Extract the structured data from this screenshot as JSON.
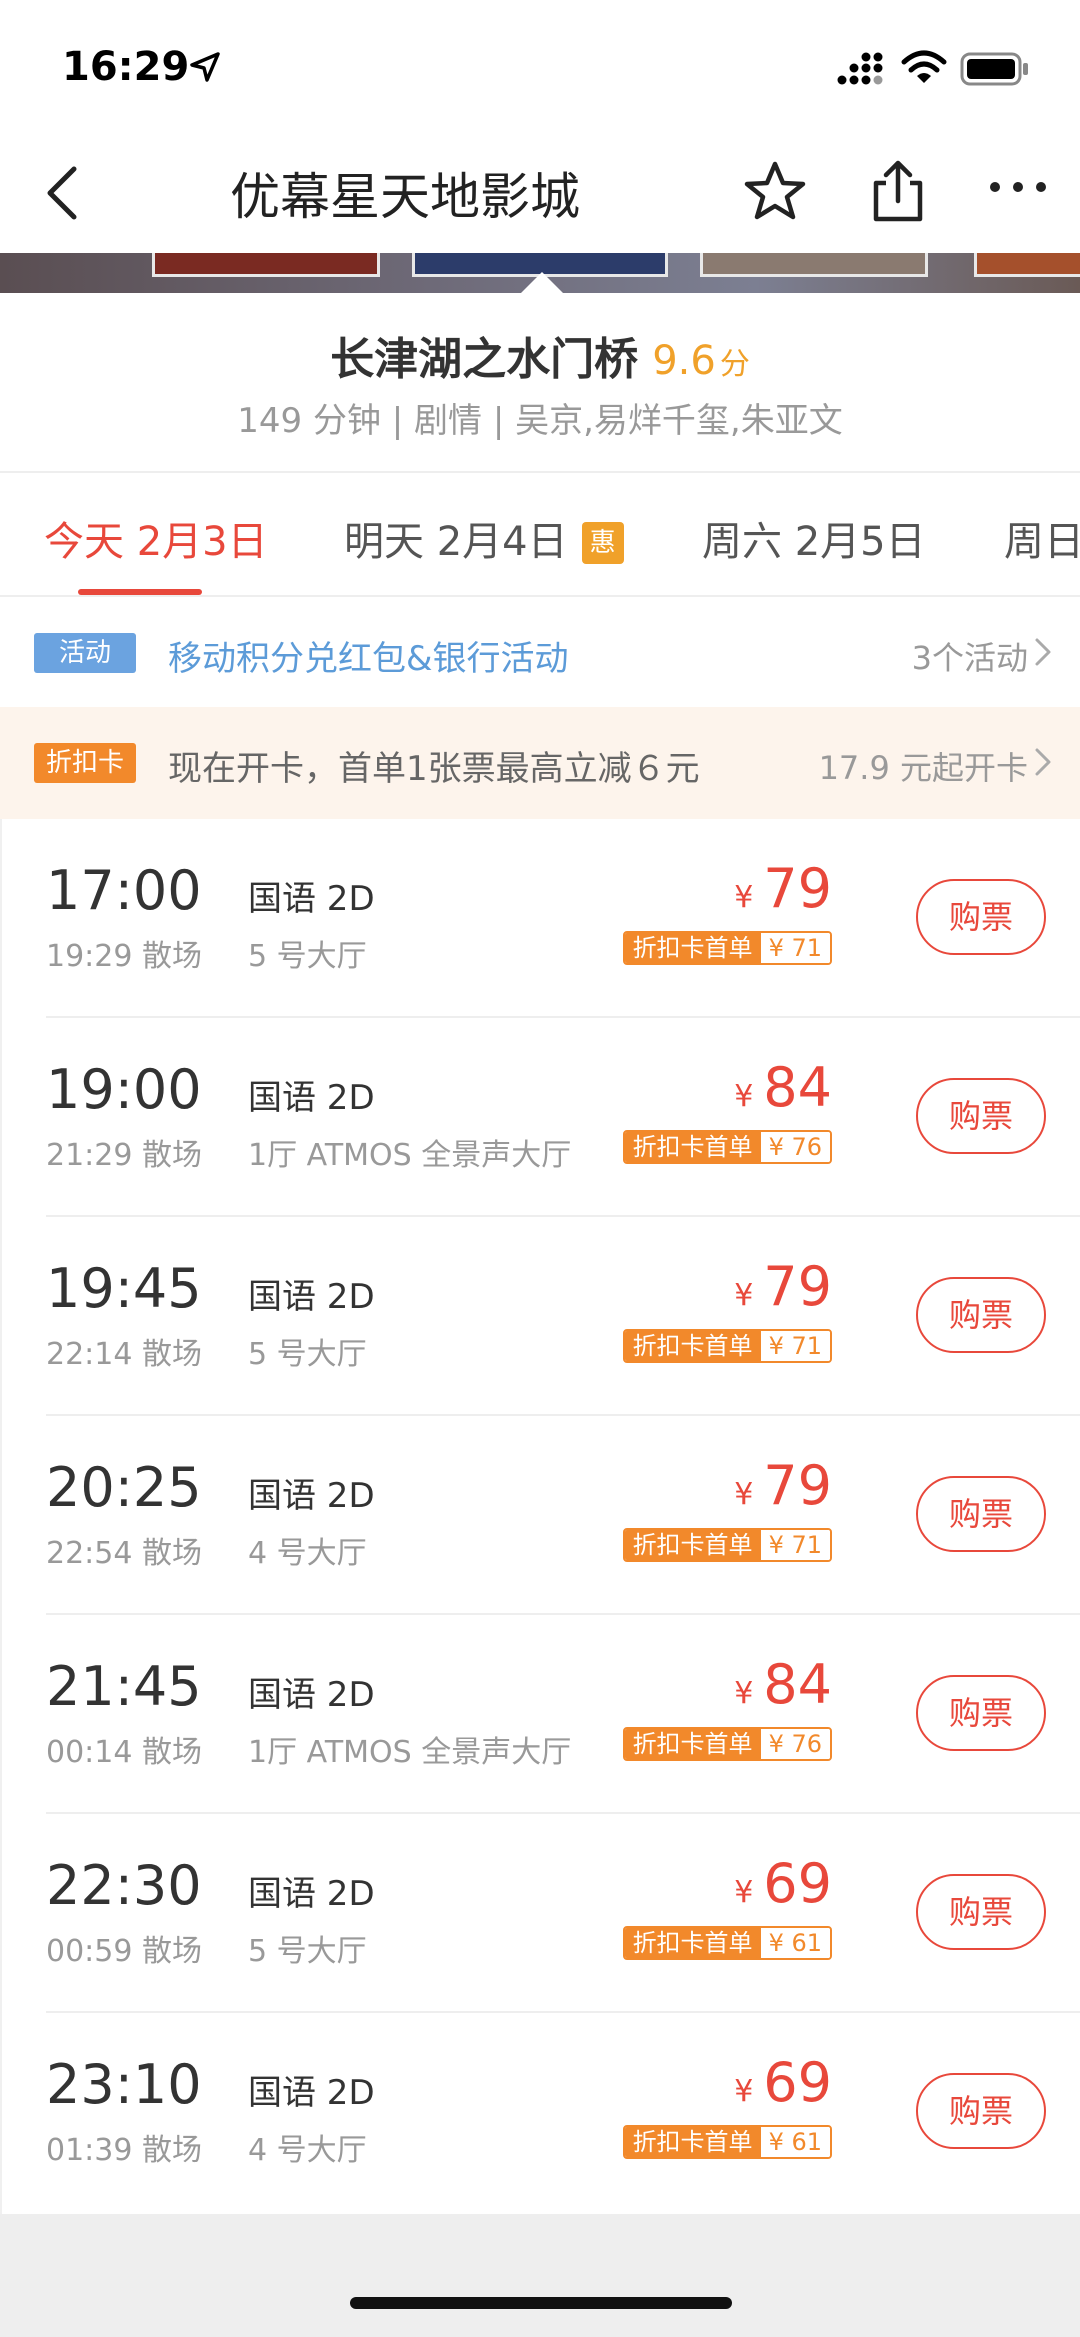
{
  "status_bar": {
    "time": "16:29",
    "icons": [
      "location-arrow-icon",
      "signal-icon",
      "wifi-icon",
      "battery-icon"
    ]
  },
  "nav": {
    "title": "优幕星天地影城",
    "icons": [
      "back-icon",
      "star-icon",
      "share-icon",
      "more-icon"
    ]
  },
  "movie": {
    "title": "长津湖之水门桥",
    "score": "9.6",
    "score_unit": "分",
    "meta": "149 分钟 | 剧情 | 吴京,易烊千玺,朱亚文"
  },
  "date_tabs": [
    {
      "label": "今天 2月3日",
      "active": true
    },
    {
      "label": "明天 2月4日",
      "badge": "惠"
    },
    {
      "label": "周六 2月5日"
    },
    {
      "label": "周日"
    }
  ],
  "activity": {
    "tag": "活动",
    "text": "移动积分兑红包&银行活动",
    "count": "3个活动"
  },
  "card_promo": {
    "tag": "折扣卡",
    "text": "现在开卡，首单1张票最高立减６元",
    "price": "17.9 元起开卡"
  },
  "showtimes": [
    {
      "start": "17:00",
      "end": "19:29 散场",
      "lang": "国语 2D",
      "hall": "5 号大厅",
      "currency": "¥",
      "price": "79",
      "discount_label": "折扣卡首单",
      "discount_price": "¥ 71",
      "buy": "购票"
    },
    {
      "start": "19:00",
      "end": "21:29 散场",
      "lang": "国语 2D",
      "hall": "1厅 ATMOS 全景声大厅",
      "currency": "¥",
      "price": "84",
      "discount_label": "折扣卡首单",
      "discount_price": "¥ 76",
      "buy": "购票"
    },
    {
      "start": "19:45",
      "end": "22:14 散场",
      "lang": "国语 2D",
      "hall": "5 号大厅",
      "currency": "¥",
      "price": "79",
      "discount_label": "折扣卡首单",
      "discount_price": "¥ 71",
      "buy": "购票"
    },
    {
      "start": "20:25",
      "end": "22:54 散场",
      "lang": "国语 2D",
      "hall": "4 号大厅",
      "currency": "¥",
      "price": "79",
      "discount_label": "折扣卡首单",
      "discount_price": "¥ 71",
      "buy": "购票"
    },
    {
      "start": "21:45",
      "end": "00:14 散场",
      "lang": "国语 2D",
      "hall": "1厅 ATMOS 全景声大厅",
      "currency": "¥",
      "price": "84",
      "discount_label": "折扣卡首单",
      "discount_price": "¥ 76",
      "buy": "购票"
    },
    {
      "start": "22:30",
      "end": "00:59 散场",
      "lang": "国语 2D",
      "hall": "5 号大厅",
      "currency": "¥",
      "price": "69",
      "discount_label": "折扣卡首单",
      "discount_price": "¥ 61",
      "buy": "购票"
    },
    {
      "start": "23:10",
      "end": "01:39 散场",
      "lang": "国语 2D",
      "hall": "4 号大厅",
      "currency": "¥",
      "price": "69",
      "discount_label": "折扣卡首单",
      "discount_price": "¥ 61",
      "buy": "购票"
    }
  ],
  "colors": {
    "accent_red": "#e8483b",
    "score_orange": "#f0a12a",
    "discount_orange": "#f2892b",
    "activity_blue": "#6ba3e0"
  }
}
